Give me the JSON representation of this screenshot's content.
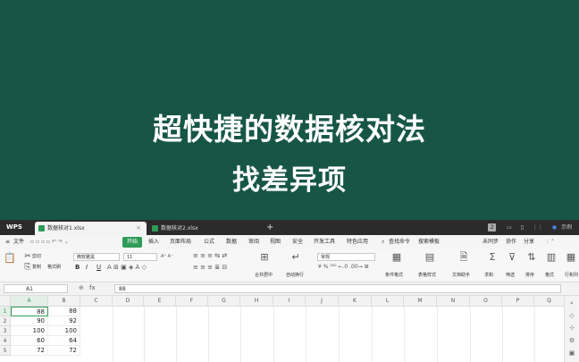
{
  "banner": {
    "line1": "超快捷的数据核对法",
    "line2": "找差异项",
    "bg_color": "#175646"
  },
  "tabs": {
    "logo": "WPS",
    "active_doc": "数据核对1.xlsx",
    "inactive_doc": "数据核对2.xlsx",
    "badge": "2",
    "user": "示例"
  },
  "menu": {
    "file": "文件",
    "items": [
      "开始",
      "插入",
      "页面布局",
      "公式",
      "数据",
      "审阅",
      "视图",
      "安全",
      "开发工具",
      "特色应用"
    ],
    "search": "查找命令",
    "search2": "搜索模板",
    "right1": "未同步",
    "right2": "协作",
    "right3": "分享"
  },
  "ribbon": {
    "cut": "剪切",
    "copy": "复制",
    "format_painter": "格式刷",
    "paste": "粘贴",
    "font_name": "微软雅黑",
    "font_size": "11",
    "merge": "合并居中",
    "wrap": "自动换行",
    "number_format": "常规",
    "conditional": "条件格式",
    "table_style": "表格样式",
    "doc_helper": "文档助手",
    "sum": "求和",
    "filter": "筛选",
    "sort": "排序",
    "format": "格式",
    "row_col": "行和列"
  },
  "formula_bar": {
    "cell_ref": "A1",
    "fx": "fx",
    "value": "88"
  },
  "grid": {
    "columns": [
      "A",
      "B",
      "C",
      "D",
      "E",
      "F",
      "G",
      "H",
      "I",
      "J",
      "K",
      "L",
      "M",
      "N",
      "O",
      "P",
      "Q"
    ],
    "rows": [
      "1",
      "2",
      "3",
      "4",
      "5"
    ],
    "data": [
      [
        "88",
        "88"
      ],
      [
        "90",
        "92"
      ],
      [
        "100",
        "100"
      ],
      [
        "60",
        "64"
      ],
      [
        "72",
        "72"
      ]
    ],
    "accent": "#2e9b57"
  }
}
